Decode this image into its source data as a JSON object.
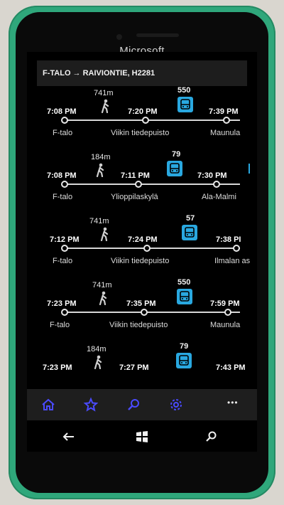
{
  "device": {
    "brand": "Microsoft"
  },
  "colors": {
    "accent": "#29a8e0",
    "appbar_icon": "#4a4aff"
  },
  "header": {
    "title": "F-TALO → RAIVIONTIE, H2281"
  },
  "routes": [
    {
      "walk": "741m",
      "line": "550",
      "times": [
        "7:08 PM",
        "7:20 PM",
        "7:39 PM"
      ],
      "stops": [
        "F-talo",
        "Viikin tiedepuisto",
        "Maunula"
      ]
    },
    {
      "walk": "184m",
      "line": "79",
      "times": [
        "7:08 PM",
        "7:11 PM",
        "7:30 PM"
      ],
      "stops": [
        "F-talo",
        "Ylioppilaskylä",
        "Ala-Malmi"
      ]
    },
    {
      "walk": "741m",
      "line": "57",
      "times": [
        "7:12 PM",
        "7:24 PM",
        "7:38 PI"
      ],
      "stops": [
        "F-talo",
        "Viikin tiedepuisto",
        "Ilmalan as"
      ]
    },
    {
      "walk": "741m",
      "line": "550",
      "times": [
        "7:23 PM",
        "7:35 PM",
        "7:59 PM"
      ],
      "stops": [
        "F-talo",
        "Viikin tiedepuisto",
        "Maunula"
      ]
    },
    {
      "walk": "184m",
      "line": "79",
      "times": [
        "7:23 PM",
        "7:27 PM",
        "7:43 PM"
      ],
      "stops": []
    }
  ],
  "appbar": {
    "more_label": "•••"
  }
}
